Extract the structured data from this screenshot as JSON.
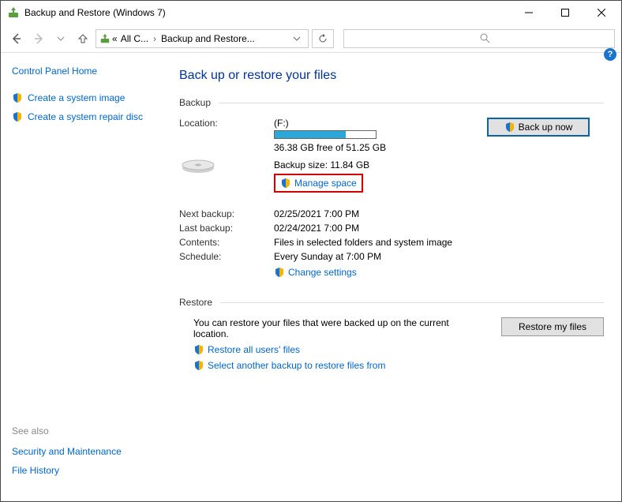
{
  "title": "Backup and Restore (Windows 7)",
  "breadcrumb": {
    "part1": "All C...",
    "part2": "Backup and Restore..."
  },
  "side": {
    "home": "Control Panel Home",
    "link1": "Create a system image",
    "link2": "Create a system repair disc",
    "seealso": "See also",
    "link3": "Security and Maintenance",
    "link4": "File History"
  },
  "heading": "Back up or restore your files",
  "section_backup": "Backup",
  "labels": {
    "location": "Location:",
    "next": "Next backup:",
    "last": "Last backup:",
    "contents": "Contents:",
    "schedule": "Schedule:"
  },
  "loc": {
    "name": "(F:)",
    "free": "36.38 GB free of 51.25 GB",
    "bsize": "Backup size: 11.84 GB",
    "manage": "Manage space"
  },
  "backup_btn": "Back up now",
  "vals": {
    "next": "02/25/2021 7:00 PM",
    "last": "02/24/2021 7:00 PM",
    "contents": "Files in selected folders and system image",
    "schedule": "Every Sunday at 7:00 PM"
  },
  "change": "Change settings",
  "section_restore": "Restore",
  "restore": {
    "desc": "You can restore your files that were backed up on the current location.",
    "btn": "Restore my files",
    "link1": "Restore all users' files",
    "link2": "Select another backup to restore files from"
  }
}
